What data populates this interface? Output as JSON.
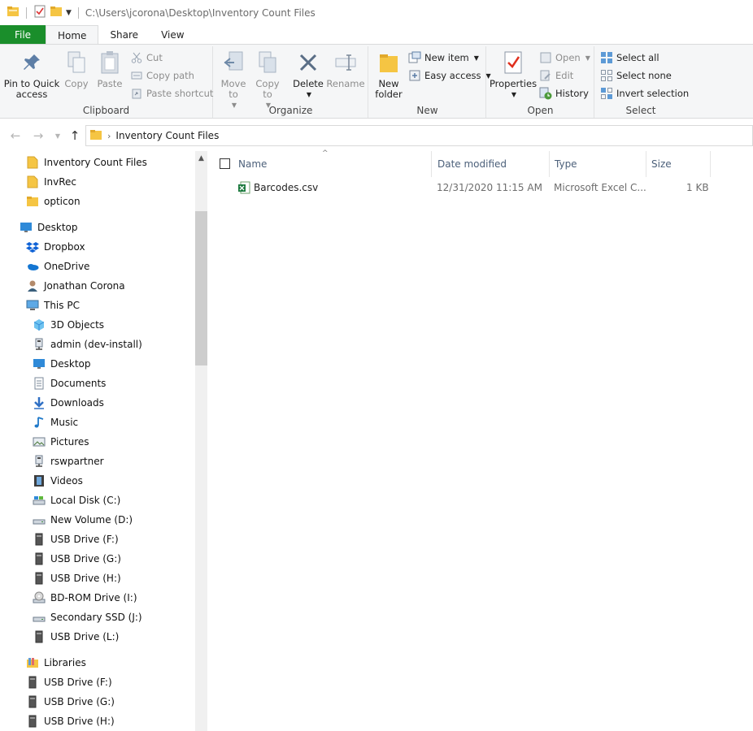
{
  "titlebar": {
    "path": "C:\\Users\\jcorona\\Desktop\\Inventory Count Files"
  },
  "tabs": [
    {
      "label": "File"
    },
    {
      "label": "Home"
    },
    {
      "label": "Share"
    },
    {
      "label": "View"
    }
  ],
  "ribbon": {
    "clipboard": {
      "label": "Clipboard",
      "pin": "Pin to Quick access",
      "copy": "Copy",
      "paste": "Paste",
      "cut": "Cut",
      "copy_path": "Copy path",
      "paste_shortcut": "Paste shortcut"
    },
    "organize": {
      "label": "Organize",
      "move_to": "Move to",
      "copy_to": "Copy to",
      "delete": "Delete",
      "rename": "Rename"
    },
    "new": {
      "label": "New",
      "new_folder": "New folder",
      "new_item": "New item",
      "easy_access": "Easy access"
    },
    "open": {
      "label": "Open",
      "properties": "Properties",
      "open": "Open",
      "edit": "Edit",
      "history": "History"
    },
    "select": {
      "label": "Select",
      "select_all": "Select all",
      "select_none": "Select none",
      "invert_selection": "Invert selection"
    }
  },
  "address": {
    "crumb": "Inventory Count Files"
  },
  "navpane": {
    "items": [
      {
        "label": "Inventory Count Files",
        "icon": "pinned-folder-icon"
      },
      {
        "label": "InvRec",
        "icon": "pinned-folder-icon"
      },
      {
        "label": "opticon",
        "icon": "folder-icon"
      },
      {
        "label": "Desktop",
        "icon": "desktop-icon"
      },
      {
        "label": "Dropbox",
        "icon": "dropbox-icon"
      },
      {
        "label": "OneDrive",
        "icon": "onedrive-icon"
      },
      {
        "label": "Jonathan Corona",
        "icon": "user-icon"
      },
      {
        "label": "This PC",
        "icon": "this-pc-icon"
      },
      {
        "label": "3D Objects",
        "icon": "3d-objects-icon"
      },
      {
        "label": "admin (dev-install)",
        "icon": "network-drive-icon"
      },
      {
        "label": "Desktop",
        "icon": "desktop-icon"
      },
      {
        "label": "Documents",
        "icon": "documents-icon"
      },
      {
        "label": "Downloads",
        "icon": "downloads-icon"
      },
      {
        "label": "Music",
        "icon": "music-icon"
      },
      {
        "label": "Pictures",
        "icon": "pictures-icon"
      },
      {
        "label": "rswpartner",
        "icon": "network-drive-icon"
      },
      {
        "label": "Videos",
        "icon": "videos-icon"
      },
      {
        "label": "Local Disk (C:)",
        "icon": "local-disk-icon"
      },
      {
        "label": "New Volume (D:)",
        "icon": "drive-icon"
      },
      {
        "label": "USB Drive (F:)",
        "icon": "usb-drive-icon"
      },
      {
        "label": "USB Drive (G:)",
        "icon": "usb-drive-icon"
      },
      {
        "label": "USB Drive (H:)",
        "icon": "usb-drive-icon"
      },
      {
        "label": "BD-ROM Drive (I:)",
        "icon": "bd-rom-icon"
      },
      {
        "label": "Secondary SSD (J:)",
        "icon": "drive-icon"
      },
      {
        "label": "USB Drive (L:)",
        "icon": "usb-drive-icon"
      },
      {
        "label": "Libraries",
        "icon": "libraries-icon"
      },
      {
        "label": "USB Drive (F:)",
        "icon": "usb-drive-icon"
      },
      {
        "label": "USB Drive (G:)",
        "icon": "usb-drive-icon"
      },
      {
        "label": "USB Drive (H:)",
        "icon": "usb-drive-icon"
      }
    ]
  },
  "columns": {
    "name": "Name",
    "date": "Date modified",
    "type": "Type",
    "size": "Size"
  },
  "files": [
    {
      "name": "Barcodes.csv",
      "date": "12/31/2020 11:15 AM",
      "type": "Microsoft Excel C...",
      "size": "1 KB"
    }
  ],
  "colors": {
    "file_tab": "#1a8e2b",
    "column_header": "#4c607a",
    "folder": "#f5c543"
  }
}
